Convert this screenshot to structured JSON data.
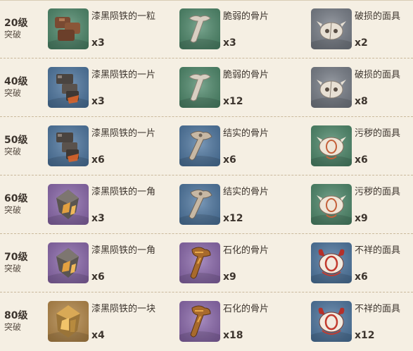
{
  "rows": [
    {
      "level": "20级",
      "sub": "突破",
      "items": [
        {
          "name": "漆黑陨铁的一粒",
          "qty": "x3",
          "icon": "iron-grain-icon",
          "bg": "green"
        },
        {
          "name": "脆弱的骨片",
          "qty": "x3",
          "icon": "fragile-bone-icon",
          "bg": "green"
        },
        {
          "name": "破损的面具",
          "qty": "x2",
          "icon": "damaged-mask-icon",
          "bg": "gray"
        }
      ]
    },
    {
      "level": "40级",
      "sub": "突破",
      "items": [
        {
          "name": "漆黑陨铁的一片",
          "qty": "x3",
          "icon": "iron-piece-icon",
          "bg": "blue"
        },
        {
          "name": "脆弱的骨片",
          "qty": "x12",
          "icon": "fragile-bone-icon",
          "bg": "green"
        },
        {
          "name": "破损的面具",
          "qty": "x8",
          "icon": "damaged-mask-icon",
          "bg": "gray"
        }
      ]
    },
    {
      "level": "50级",
      "sub": "突破",
      "items": [
        {
          "name": "漆黑陨铁的一片",
          "qty": "x6",
          "icon": "iron-piece-icon",
          "bg": "blue"
        },
        {
          "name": "结实的骨片",
          "qty": "x6",
          "icon": "sturdy-bone-icon",
          "bg": "blue"
        },
        {
          "name": "污秽的面具",
          "qty": "x6",
          "icon": "stained-mask-icon",
          "bg": "green"
        }
      ]
    },
    {
      "level": "60级",
      "sub": "突破",
      "items": [
        {
          "name": "漆黑陨铁的一角",
          "qty": "x3",
          "icon": "iron-chunk-icon",
          "bg": "purple"
        },
        {
          "name": "结实的骨片",
          "qty": "x12",
          "icon": "sturdy-bone-icon",
          "bg": "blue"
        },
        {
          "name": "污秽的面具",
          "qty": "x9",
          "icon": "stained-mask-icon",
          "bg": "green"
        }
      ]
    },
    {
      "level": "70级",
      "sub": "突破",
      "items": [
        {
          "name": "漆黑陨铁的一角",
          "qty": "x6",
          "icon": "iron-chunk-icon",
          "bg": "purple"
        },
        {
          "name": "石化的骨片",
          "qty": "x9",
          "icon": "fossilized-bone-icon",
          "bg": "purple"
        },
        {
          "name": "不祥的面具",
          "qty": "x6",
          "icon": "ominous-mask-icon",
          "bg": "blue"
        }
      ]
    },
    {
      "level": "80级",
      "sub": "突破",
      "items": [
        {
          "name": "漆黑陨铁的一块",
          "qty": "x4",
          "icon": "iron-block-icon",
          "bg": "gold"
        },
        {
          "name": "石化的骨片",
          "qty": "x18",
          "icon": "fossilized-bone-icon",
          "bg": "purple"
        },
        {
          "name": "不祥的面具",
          "qty": "x12",
          "icon": "ominous-mask-icon",
          "bg": "blue"
        }
      ]
    }
  ],
  "colors": {
    "bg_green": "#4f8a6c",
    "bg_blue": "#4f78a2",
    "bg_purple": "#8d6aae",
    "bg_gold": "#b78a4a",
    "bg_gray": "#7a808a"
  }
}
